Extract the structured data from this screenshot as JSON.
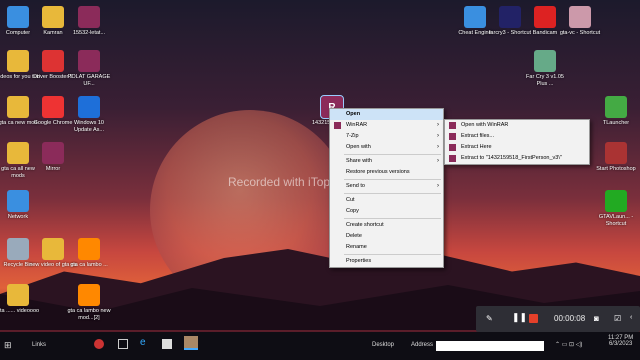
{
  "desktop": {
    "icons_left": [
      {
        "label": "Computer",
        "icon": "computer-icon",
        "color": "#3a8fe0"
      },
      {
        "label": "Kamran",
        "icon": "folder-icon",
        "color": "#e8b83a"
      },
      {
        "label": "15532-letat...",
        "icon": "winrar-icon",
        "color": "#8b2b5a"
      },
      {
        "label": "videos for you tub",
        "icon": "folder-icon",
        "color": "#e8b83a"
      },
      {
        "label": "Driver Booster 9",
        "icon": "driver-booster-icon",
        "color": "#d33"
      },
      {
        "label": "POLAT GARAGE UF...",
        "icon": "winrar-icon",
        "color": "#8b2b5a"
      },
      {
        "label": "gta ca new mod",
        "icon": "folder-icon",
        "color": "#e8b83a"
      },
      {
        "label": "Google Chrome",
        "icon": "chrome-icon",
        "color": "#e33"
      },
      {
        "label": "Windows 10 Update As...",
        "icon": "windows-icon",
        "color": "#1e6fd9"
      },
      {
        "label": "gta ca all new mods",
        "icon": "folder-icon",
        "color": "#e8b83a"
      },
      {
        "label": "Mirror",
        "icon": "winrar-icon",
        "color": "#8b2b5a"
      },
      {
        "label": "Network",
        "icon": "network-icon",
        "color": "#3a8fe0"
      },
      {
        "label": "Recycle Bin",
        "icon": "recycle-bin-icon",
        "color": "#9ab"
      },
      {
        "label": "new video of gta ca",
        "icon": "folder-icon",
        "color": "#e8b83a"
      },
      {
        "label": "gta ca lambo ...",
        "icon": "vlc-icon",
        "color": "#f80"
      },
      {
        "label": "gta ...... videoooo",
        "icon": "folder-icon",
        "color": "#e8b83a"
      },
      {
        "label": "gta ca lambo new mod...[2]",
        "icon": "vlc-icon",
        "color": "#f80"
      }
    ],
    "icons_right": [
      {
        "label": "Cheat Engine",
        "icon": "cheat-engine-icon",
        "color": "#3a8fe0"
      },
      {
        "label": "farcry3 - Shortcut",
        "icon": "farcry-icon",
        "color": "#226"
      },
      {
        "label": "Bandicam",
        "icon": "bandicam-icon",
        "color": "#d22"
      },
      {
        "label": "gta-vc - Shortcut",
        "icon": "gta-icon",
        "color": "#c9a"
      },
      {
        "label": "Far Cry 3 v1.05 Plus ...",
        "icon": "farcry-trainer-icon",
        "color": "#6a8"
      },
      {
        "label": "TLauncher",
        "icon": "tlauncher-icon",
        "color": "#4a4"
      },
      {
        "label": "Start Photoshop",
        "icon": "photoshop-icon",
        "color": "#a33"
      },
      {
        "label": "GTAVLaun... - Shortcut",
        "icon": "gtav-icon",
        "color": "#2a2"
      }
    ],
    "selected_file_label": "1432159518_FirstP..."
  },
  "watermark": "Recorded with iTop Screen Recorder",
  "context_menu": {
    "items": [
      "Open",
      "WinRAR",
      "7-Zip",
      "Open with",
      "Share with",
      "Restore previous versions",
      "Send to",
      "Cut",
      "Copy",
      "Create shortcut",
      "Delete",
      "Rename",
      "Properties"
    ]
  },
  "submenu": {
    "items": [
      "Open with WinRAR",
      "Extract files...",
      "Extract Here",
      "Extract to \"1432159518_FirstPerson_v3\\\""
    ]
  },
  "recorder": {
    "time": "00:00:08"
  },
  "taskbar": {
    "links_label": "Links",
    "desktop_label": "Desktop",
    "address_label": "Address",
    "time": "11:27 PM",
    "date": "6/3/2023"
  }
}
